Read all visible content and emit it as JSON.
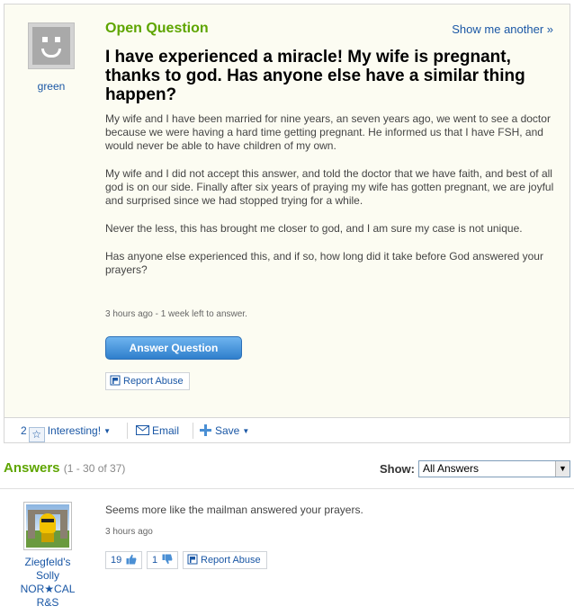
{
  "question": {
    "header_label": "Open Question",
    "show_another": "Show me another »",
    "asker_name": "green",
    "title": "I have experienced a miracle! My wife is pregnant, thanks to god. Has anyone else have a similar thing happen?",
    "body": [
      "My wife and I have been married for nine years, an seven years ago, we went to see a doctor because we were having a hard time getting pregnant. He informed us that I have FSH, and would never be able to have children of my own.",
      "My wife and I did not accept this answer, and told the doctor that we have faith, and best of all god is on our side. Finally after six years of praying my wife has gotten pregnant, we are joyful and surprised since we had stopped trying for a while.",
      "Never the less, this has brought me closer to god, and I am sure my case is not unique.",
      "Has anyone else experienced this, and if so, how long did it take before God answered your prayers?"
    ],
    "meta": "3 hours ago - 1 week left to answer.",
    "answer_button": "Answer Question",
    "report_abuse": "Report Abuse"
  },
  "actions": {
    "interesting_count": "2",
    "interesting_label": "Interesting!",
    "email_label": "Email",
    "save_label": "Save"
  },
  "answers": {
    "heading": "Answers",
    "range": "(1 - 30 of 37)",
    "show_label": "Show:",
    "show_selected": "All Answers",
    "items": [
      {
        "author_lines": [
          "Ziegfeld's",
          "Solly",
          "NOR★CAL",
          "R&S"
        ],
        "text": "Seems more like the mailman answered your prayers.",
        "time": "3 hours ago",
        "thumbs_up": "19",
        "thumbs_down": "1",
        "report_abuse": "Report Abuse"
      }
    ]
  },
  "colors": {
    "accent_green": "#5ea500",
    "link_blue": "#1a57a5",
    "panel_bg": "#fcfcf2",
    "button_blue": "#2f7fcc"
  },
  "icons": [
    "default-avatar-icon",
    "flag-icon",
    "star-icon",
    "envelope-icon",
    "plus-icon",
    "thumbs-up-icon",
    "thumbs-down-icon"
  ]
}
